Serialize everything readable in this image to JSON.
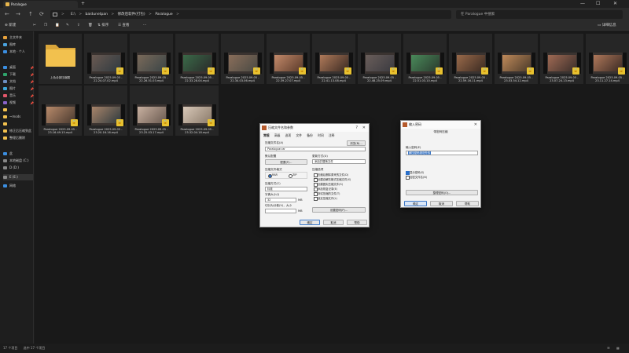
{
  "titlebar": {
    "tab_title": "Paralogue",
    "new_tab": "+",
    "minimize": "—",
    "maximize": "☐",
    "close": "✕"
  },
  "nav": {
    "back": "←",
    "forward": "→",
    "up": "↑",
    "refresh": "⟳",
    "path": [
      "E:\\",
      "baidunetpan",
      "修改后软件(打包)",
      "Paralogue"
    ],
    "path_sep": ">",
    "search_placeholder": "在 Paralogue 中搜索"
  },
  "toolbar": {
    "new": "新建",
    "sort": "排序",
    "view": "查看",
    "more": "···",
    "details": "详细信息"
  },
  "sidebar": {
    "home": "主文件夹",
    "gallery": "图库",
    "onedrive": "本地 · 个人",
    "desktop": "桌面",
    "downloads": "下载",
    "documents": "文档",
    "pictures": "图片",
    "music": "音乐",
    "videos": "视频",
    "folder1": "",
    "folder2": "~mods",
    "folder3": "",
    "folder4": "修正后压缩到此",
    "folder5": "整理后删除",
    "this_pc": "此",
    "drive_c": "本地磁盘 (C:)",
    "drive_d": "D (D:)",
    "drive_e": "E (E:)",
    "network": "网络"
  },
  "files": [
    {
      "name": "上色全部压缩图",
      "type": "folder"
    },
    {
      "name": "Paralogue 2025.09.05 - 22.24.07.02.mp4",
      "type": "video"
    },
    {
      "name": "Paralogue 2025.09.05 - 22.26.51.03.mp4",
      "type": "video"
    },
    {
      "name": "Paralogue 2025.09.05 - 22.33.28.04.mp4",
      "type": "video"
    },
    {
      "name": "Paralogue 2025.09.05 - 22.34.03.06.mp4",
      "type": "video"
    },
    {
      "name": "Paralogue 2025.09.05 - 22.39.27.07.mp4",
      "type": "video"
    },
    {
      "name": "Paralogue 2025.09.05 - 22.41.13.08.mp4",
      "type": "video"
    },
    {
      "name": "Paralogue 2025.09.05 - 22.48.25.09.mp4",
      "type": "video"
    },
    {
      "name": "Paralogue 2025.09.05 - 22.51.03.10.mp4",
      "type": "video"
    },
    {
      "name": "Paralogue 2025.09.05 - 22.59.16.11.mp4",
      "type": "video"
    },
    {
      "name": "Paralogue 2025.09.05 - 23.03.54.12.mp4",
      "type": "video"
    },
    {
      "name": "Paralogue 2025.09.05 - 23.07.24.13.mp4",
      "type": "video"
    },
    {
      "name": "Paralogue 2025.09.05 - 23.11.27.14.mp4",
      "type": "video"
    },
    {
      "name": "Paralogue 2025.09.05 - 23.16.49.15.mp4",
      "type": "video"
    },
    {
      "name": "Paralogue 2025.09.05 - 23.20.16.16.mp4",
      "type": "video"
    },
    {
      "name": "Paralogue 2025.09.05 - 23.25.03.17.mp4",
      "type": "video"
    },
    {
      "name": "Paralogue 2025.09.05 - 23.32.04.18.mp4",
      "type": "video"
    }
  ],
  "statusbar": {
    "count": "17 个项目",
    "selected": "选中 17 个项目"
  },
  "archive_dialog": {
    "title": "压缩文件名和参数",
    "tabs": [
      "常规",
      "高级",
      "选项",
      "文件",
      "备份",
      "时间",
      "注释"
    ],
    "archive_name_label": "压缩文件名(A)",
    "archive_name_value": "Paralogue.rar",
    "browse_button": "浏览(B)...",
    "default_profile_label": "默认配置",
    "profile_button": "配置(F)...",
    "update_mode_label": "更新方式(U)",
    "update_mode_value": "添加并替换文件",
    "format_label": "压缩文件格式",
    "format_rar": "RAR",
    "format_zip": "ZIP",
    "method_label": "压缩方式(C)",
    "method_value": "标准",
    "dict_label": "字典大小(I)",
    "dict_value": "32",
    "dict_unit": "MB",
    "split_label": "切分为分卷(V)，大小",
    "split_unit": "MB",
    "options_label": "压缩选项",
    "options": [
      "压缩后删除原来的文件(D)",
      "创建自解压格式压缩文件(X)",
      "创建固实压缩文件(S)",
      "添加恢复记录(E)",
      "测试压缩的文件(T)",
      "锁定压缩文件(L)"
    ],
    "password_button": "设置密码(P)...",
    "ok": "确定",
    "cancel": "取消",
    "help": "帮助"
  },
  "password_dialog": {
    "title": "输入密码",
    "subtitle": "带密码压缩",
    "enter_label": "输入密码(E)",
    "enter_value": "解压密码请勿外传",
    "confirm_label": "",
    "show_password": "显示密码(S)",
    "encrypt_names": "加密文件名(N)",
    "manage_button": "整理密码(O)...",
    "ok": "确定",
    "cancel": "取消",
    "help": "帮助"
  },
  "colors": {
    "accent": "#2a6fc9",
    "folder": "#f2c14e",
    "badge": "#e8c230"
  }
}
